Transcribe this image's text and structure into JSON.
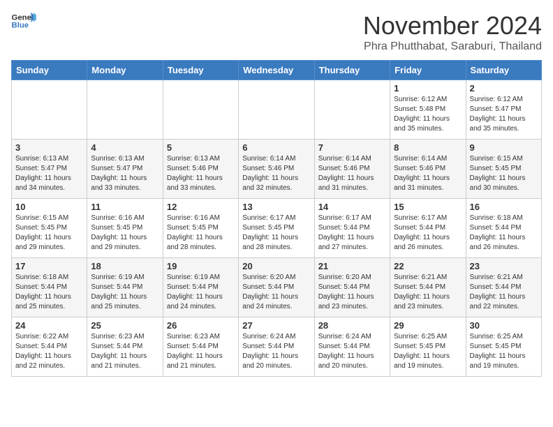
{
  "header": {
    "logo_general": "General",
    "logo_blue": "Blue",
    "month_title": "November 2024",
    "subtitle": "Phra Phutthabat, Saraburi, Thailand"
  },
  "days_of_week": [
    "Sunday",
    "Monday",
    "Tuesday",
    "Wednesday",
    "Thursday",
    "Friday",
    "Saturday"
  ],
  "weeks": [
    [
      {
        "day": "",
        "info": ""
      },
      {
        "day": "",
        "info": ""
      },
      {
        "day": "",
        "info": ""
      },
      {
        "day": "",
        "info": ""
      },
      {
        "day": "",
        "info": ""
      },
      {
        "day": "1",
        "info": "Sunrise: 6:12 AM\nSunset: 5:48 PM\nDaylight: 11 hours and 35 minutes."
      },
      {
        "day": "2",
        "info": "Sunrise: 6:12 AM\nSunset: 5:47 PM\nDaylight: 11 hours and 35 minutes."
      }
    ],
    [
      {
        "day": "3",
        "info": "Sunrise: 6:13 AM\nSunset: 5:47 PM\nDaylight: 11 hours and 34 minutes."
      },
      {
        "day": "4",
        "info": "Sunrise: 6:13 AM\nSunset: 5:47 PM\nDaylight: 11 hours and 33 minutes."
      },
      {
        "day": "5",
        "info": "Sunrise: 6:13 AM\nSunset: 5:46 PM\nDaylight: 11 hours and 33 minutes."
      },
      {
        "day": "6",
        "info": "Sunrise: 6:14 AM\nSunset: 5:46 PM\nDaylight: 11 hours and 32 minutes."
      },
      {
        "day": "7",
        "info": "Sunrise: 6:14 AM\nSunset: 5:46 PM\nDaylight: 11 hours and 31 minutes."
      },
      {
        "day": "8",
        "info": "Sunrise: 6:14 AM\nSunset: 5:46 PM\nDaylight: 11 hours and 31 minutes."
      },
      {
        "day": "9",
        "info": "Sunrise: 6:15 AM\nSunset: 5:45 PM\nDaylight: 11 hours and 30 minutes."
      }
    ],
    [
      {
        "day": "10",
        "info": "Sunrise: 6:15 AM\nSunset: 5:45 PM\nDaylight: 11 hours and 29 minutes."
      },
      {
        "day": "11",
        "info": "Sunrise: 6:16 AM\nSunset: 5:45 PM\nDaylight: 11 hours and 29 minutes."
      },
      {
        "day": "12",
        "info": "Sunrise: 6:16 AM\nSunset: 5:45 PM\nDaylight: 11 hours and 28 minutes."
      },
      {
        "day": "13",
        "info": "Sunrise: 6:17 AM\nSunset: 5:45 PM\nDaylight: 11 hours and 28 minutes."
      },
      {
        "day": "14",
        "info": "Sunrise: 6:17 AM\nSunset: 5:44 PM\nDaylight: 11 hours and 27 minutes."
      },
      {
        "day": "15",
        "info": "Sunrise: 6:17 AM\nSunset: 5:44 PM\nDaylight: 11 hours and 26 minutes."
      },
      {
        "day": "16",
        "info": "Sunrise: 6:18 AM\nSunset: 5:44 PM\nDaylight: 11 hours and 26 minutes."
      }
    ],
    [
      {
        "day": "17",
        "info": "Sunrise: 6:18 AM\nSunset: 5:44 PM\nDaylight: 11 hours and 25 minutes."
      },
      {
        "day": "18",
        "info": "Sunrise: 6:19 AM\nSunset: 5:44 PM\nDaylight: 11 hours and 25 minutes."
      },
      {
        "day": "19",
        "info": "Sunrise: 6:19 AM\nSunset: 5:44 PM\nDaylight: 11 hours and 24 minutes."
      },
      {
        "day": "20",
        "info": "Sunrise: 6:20 AM\nSunset: 5:44 PM\nDaylight: 11 hours and 24 minutes."
      },
      {
        "day": "21",
        "info": "Sunrise: 6:20 AM\nSunset: 5:44 PM\nDaylight: 11 hours and 23 minutes."
      },
      {
        "day": "22",
        "info": "Sunrise: 6:21 AM\nSunset: 5:44 PM\nDaylight: 11 hours and 23 minutes."
      },
      {
        "day": "23",
        "info": "Sunrise: 6:21 AM\nSunset: 5:44 PM\nDaylight: 11 hours and 22 minutes."
      }
    ],
    [
      {
        "day": "24",
        "info": "Sunrise: 6:22 AM\nSunset: 5:44 PM\nDaylight: 11 hours and 22 minutes."
      },
      {
        "day": "25",
        "info": "Sunrise: 6:23 AM\nSunset: 5:44 PM\nDaylight: 11 hours and 21 minutes."
      },
      {
        "day": "26",
        "info": "Sunrise: 6:23 AM\nSunset: 5:44 PM\nDaylight: 11 hours and 21 minutes."
      },
      {
        "day": "27",
        "info": "Sunrise: 6:24 AM\nSunset: 5:44 PM\nDaylight: 11 hours and 20 minutes."
      },
      {
        "day": "28",
        "info": "Sunrise: 6:24 AM\nSunset: 5:44 PM\nDaylight: 11 hours and 20 minutes."
      },
      {
        "day": "29",
        "info": "Sunrise: 6:25 AM\nSunset: 5:45 PM\nDaylight: 11 hours and 19 minutes."
      },
      {
        "day": "30",
        "info": "Sunrise: 6:25 AM\nSunset: 5:45 PM\nDaylight: 11 hours and 19 minutes."
      }
    ]
  ]
}
